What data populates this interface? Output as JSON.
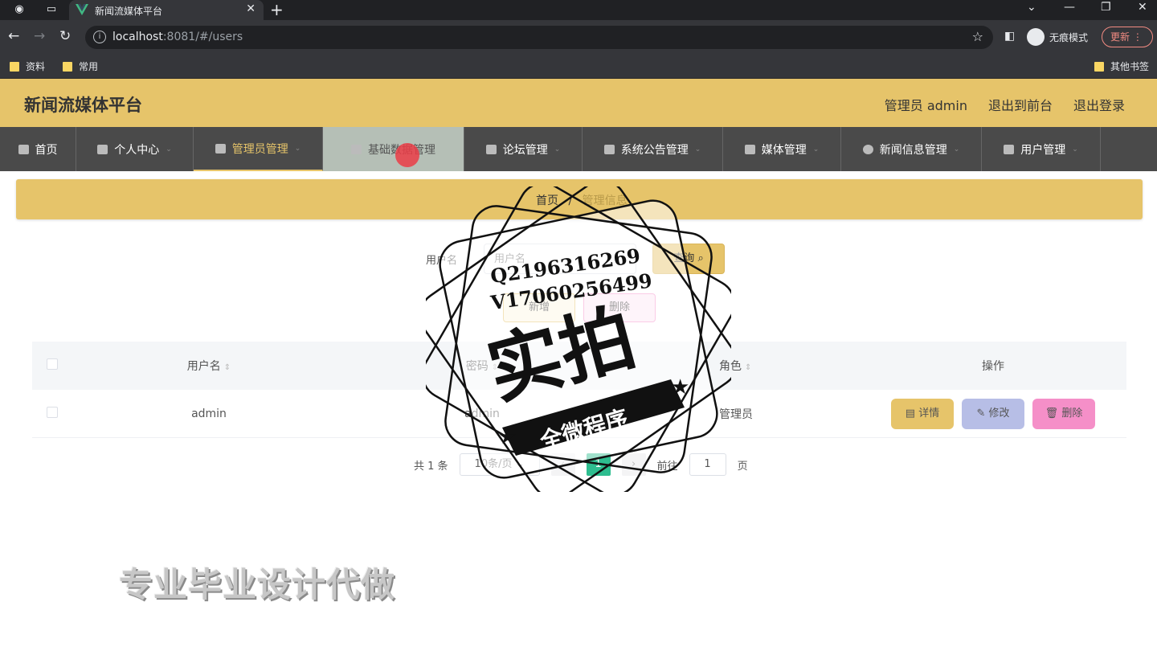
{
  "browser": {
    "tab_title": "新闻流媒体平台",
    "url_host": "localhost",
    "url_rest": ":8081/#/users",
    "incognito_label": "无痕模式",
    "update_label": "更新",
    "bookmarks": [
      "资料",
      "常用"
    ],
    "other_bookmarks": "其他书签"
  },
  "header": {
    "brand": "新闻流媒体平台",
    "user": "管理员 admin",
    "to_front": "退出到前台",
    "logout": "退出登录"
  },
  "nav": {
    "items": [
      {
        "label": "首页"
      },
      {
        "label": "个人中心"
      },
      {
        "label": "管理员管理"
      },
      {
        "label": "基础数据管理"
      },
      {
        "label": "论坛管理"
      },
      {
        "label": "系统公告管理"
      },
      {
        "label": "媒体管理"
      },
      {
        "label": "新闻信息管理"
      },
      {
        "label": "用户管理"
      }
    ]
  },
  "breadcrumb": {
    "home": "首页",
    "sep": "/",
    "current": "管理信息"
  },
  "search": {
    "label": "用户名",
    "placeholder": "用户名",
    "button": "查询"
  },
  "actions": {
    "add": "新增",
    "delete": "删除"
  },
  "table": {
    "headers": [
      "用户名",
      "密码",
      "角色",
      "操作"
    ],
    "rows": [
      {
        "username": "admin",
        "password": "admin",
        "role": "管理员"
      }
    ],
    "row_actions": {
      "detail": "详情",
      "edit": "修改",
      "delete": "删除"
    }
  },
  "pagination": {
    "total": "共 1 条",
    "page_size": "10条/页",
    "current_page": "1",
    "goto_label": "前往",
    "goto_value": "1",
    "page_suffix": "页"
  },
  "watermark": {
    "line1": "Q2196316269",
    "line2": "V17060256499",
    "big": "实拍",
    "banner": "全微程序",
    "bottom": "专业毕业设计代做"
  },
  "colors": {
    "accent": "#e6c46a",
    "nav_bg": "#4a4a4a",
    "page_active": "#2ebd8f",
    "edit": "#b7bee6",
    "delete": "#f58fc8"
  }
}
